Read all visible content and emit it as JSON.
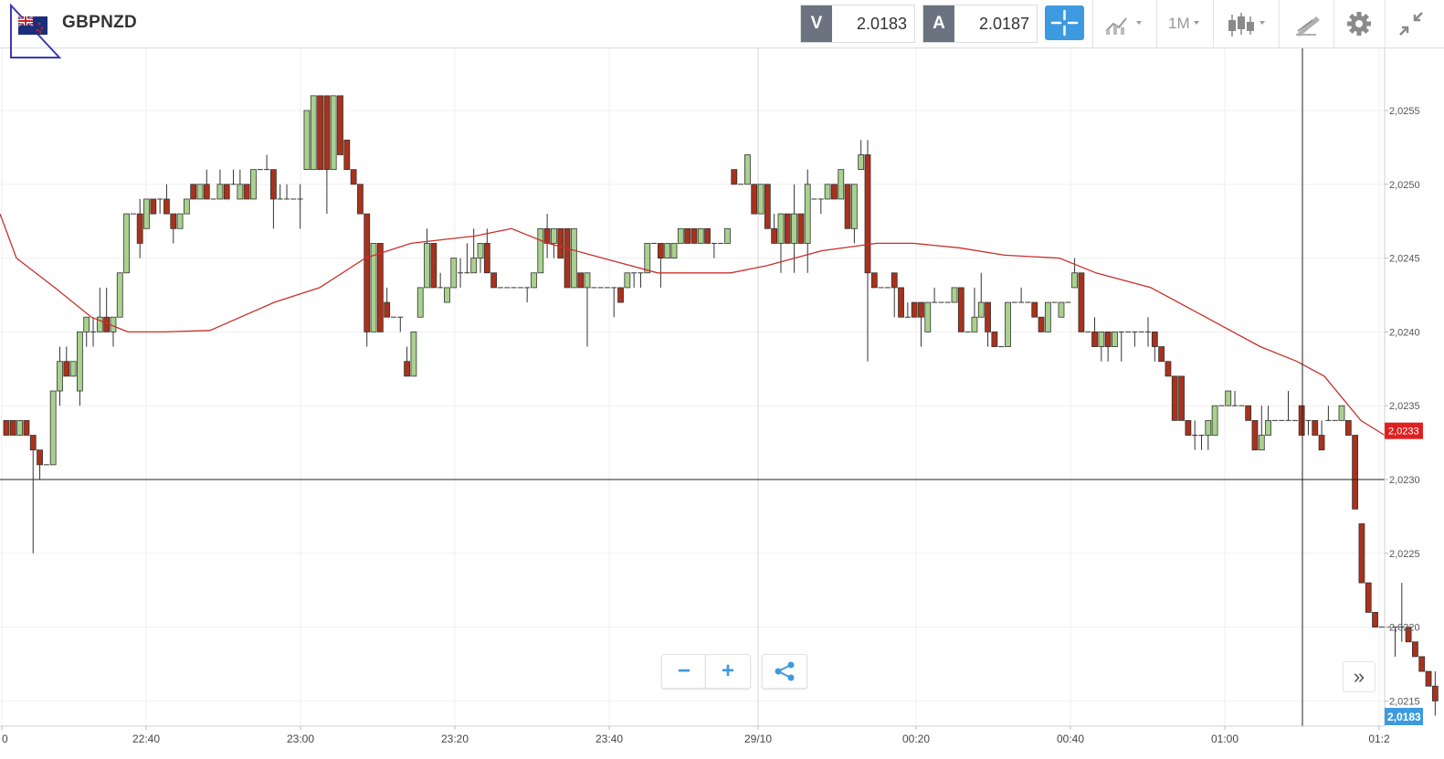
{
  "header": {
    "symbol": "GBPNZD",
    "flag_icon": "uk-nz-flag-icon",
    "sell": {
      "label": "V",
      "value": "2.0183"
    },
    "buy": {
      "label": "A",
      "value": "2.0187"
    },
    "timeframe": "1M",
    "tools": [
      "crosshair-icon",
      "indicators-icon",
      "candlestick-icon",
      "draw-icon",
      "gear-icon",
      "collapse-icon"
    ]
  },
  "chart_data": {
    "type": "candlestick",
    "y_ticks": [
      "2,0255",
      "2,0250",
      "2,0245",
      "2,0240",
      "2,0235",
      "2,0230",
      "2,0225",
      "2,0220",
      "2,0215"
    ],
    "x_ticks": [
      "0",
      "22:40",
      "23:00",
      "23:20",
      "23:40",
      "29/10",
      "00:20",
      "00:40",
      "01:00",
      "01:2"
    ],
    "ylim": [
      2.0213,
      2.0259
    ],
    "horizontal_line": 2.023,
    "crosshair_time": "01:10",
    "ma_last_label": "2,0233",
    "current_price_label": "2,0183",
    "colors": {
      "up": "#a9d18e",
      "down": "#a8321c",
      "ma": "#c8302c",
      "current_badge": "#3d9ae0",
      "ma_badge": "#e02020"
    },
    "candles": [
      [
        2.0234,
        2.0234,
        2.0233,
        2.0233
      ],
      [
        2.0234,
        2.0234,
        2.0233,
        2.0233
      ],
      [
        2.0233,
        2.0234,
        2.0233,
        2.0234
      ],
      [
        2.0234,
        2.0234,
        2.0233,
        2.0233
      ],
      [
        2.0233,
        2.0233,
        2.0225,
        2.0232
      ],
      [
        2.0232,
        2.0232,
        2.023,
        2.0231
      ],
      [
        2.0231,
        2.0231,
        2.0231,
        2.0231
      ],
      [
        2.0231,
        2.0236,
        2.0231,
        2.0236
      ],
      [
        2.0236,
        2.0239,
        2.0235,
        2.0238
      ],
      [
        2.0238,
        2.0239,
        2.0237,
        2.0237
      ],
      [
        2.0237,
        2.0238,
        2.0237,
        2.0238
      ],
      [
        2.0236,
        2.024,
        2.0235,
        2.024
      ],
      [
        2.024,
        2.0241,
        2.0239,
        2.0241
      ],
      [
        2.024,
        2.0241,
        2.0239,
        2.024
      ],
      [
        2.024,
        2.0243,
        2.024,
        2.0241
      ],
      [
        2.0241,
        2.0243,
        2.024,
        2.024
      ],
      [
        2.024,
        2.0241,
        2.0239,
        2.0241
      ],
      [
        2.0241,
        2.0244,
        2.0241,
        2.0244
      ],
      [
        2.0244,
        2.0248,
        2.0244,
        2.0248
      ],
      [
        2.0248,
        2.0248,
        2.0248,
        2.0248
      ],
      [
        2.0248,
        2.0249,
        2.0245,
        2.0246
      ],
      [
        2.0247,
        2.0249,
        2.0247,
        2.0249
      ],
      [
        2.0249,
        2.0249,
        2.0248,
        2.0248
      ],
      [
        2.0249,
        2.0249,
        2.0248,
        2.0249
      ],
      [
        2.0249,
        2.025,
        2.0248,
        2.0248
      ],
      [
        2.0248,
        2.0248,
        2.0246,
        2.0247
      ],
      [
        2.0247,
        2.0248,
        2.0247,
        2.0248
      ],
      [
        2.0248,
        2.0249,
        2.0248,
        2.0249
      ],
      [
        2.025,
        2.025,
        2.0249,
        2.0249
      ],
      [
        2.0249,
        2.025,
        2.0249,
        2.025
      ],
      [
        2.025,
        2.0251,
        2.0249,
        2.0249
      ],
      [
        2.0249,
        2.0249,
        2.0249,
        2.0249
      ],
      [
        2.0249,
        2.0251,
        2.0249,
        2.025
      ],
      [
        2.025,
        2.025,
        2.0249,
        2.0249
      ],
      [
        2.025,
        2.0251,
        2.025,
        2.025
      ],
      [
        2.0249,
        2.0251,
        2.0249,
        2.025
      ],
      [
        2.025,
        2.025,
        2.0249,
        2.0249
      ],
      [
        2.0249,
        2.0251,
        2.0249,
        2.0251
      ],
      [
        2.0251,
        2.0251,
        2.0251,
        2.0251
      ],
      [
        2.0251,
        2.0252,
        2.0251,
        2.0251
      ],
      [
        2.0251,
        2.0251,
        2.0247,
        2.0249
      ],
      [
        2.0249,
        2.025,
        2.0249,
        2.0249
      ],
      [
        2.0249,
        2.025,
        2.0249,
        2.0249
      ],
      [
        2.0249,
        2.0249,
        2.0249,
        2.0249
      ],
      [
        2.0249,
        2.025,
        2.0247,
        2.0249
      ],
      [
        2.0251,
        2.0255,
        2.0251,
        2.0255
      ],
      [
        2.0251,
        2.0256,
        2.0251,
        2.0256
      ],
      [
        2.0256,
        2.0256,
        2.0251,
        2.0251
      ],
      [
        2.0256,
        2.0256,
        2.0248,
        2.0251
      ],
      [
        2.0251,
        2.0256,
        2.0251,
        2.0256
      ],
      [
        2.0256,
        2.0256,
        2.0252,
        2.0252
      ],
      [
        2.0253,
        2.0253,
        2.0251,
        2.0251
      ],
      [
        2.0251,
        2.0251,
        2.025,
        2.025
      ],
      [
        2.025,
        2.025,
        2.0248,
        2.0248
      ],
      [
        2.0248,
        2.0248,
        2.0239,
        2.024
      ],
      [
        2.024,
        2.0246,
        2.024,
        2.0246
      ],
      [
        2.0246,
        2.0246,
        2.024,
        2.024
      ],
      [
        2.0242,
        2.0243,
        2.0241,
        2.0241
      ],
      [
        2.0241,
        2.0241,
        2.0241,
        2.0241
      ],
      [
        2.0241,
        2.0241,
        2.024,
        2.0241
      ],
      [
        2.0238,
        2.0239,
        2.0237,
        2.0237
      ],
      [
        2.0237,
        2.024,
        2.0237,
        2.024
      ],
      [
        2.0241,
        2.0243,
        2.0241,
        2.0243
      ],
      [
        2.0243,
        2.0247,
        2.0243,
        2.0246
      ],
      [
        2.0246,
        2.0246,
        2.0243,
        2.0243
      ],
      [
        2.0243,
        2.0244,
        2.0243,
        2.0243
      ],
      [
        2.0242,
        2.0243,
        2.0242,
        2.0243
      ],
      [
        2.0243,
        2.0245,
        2.0243,
        2.0245
      ],
      [
        2.0244,
        2.0245,
        2.0243,
        2.0244
      ],
      [
        2.0244,
        2.0246,
        2.0244,
        2.0244
      ],
      [
        2.0244,
        2.0247,
        2.0244,
        2.0245
      ],
      [
        2.0245,
        2.0246,
        2.0244,
        2.0246
      ],
      [
        2.0246,
        2.0247,
        2.0244,
        2.0244
      ],
      [
        2.0244,
        2.0244,
        2.0243,
        2.0243
      ],
      [
        2.0243,
        2.0243,
        2.0243,
        2.0243
      ],
      [
        2.0243,
        2.0243,
        2.0243,
        2.0243
      ],
      [
        2.0243,
        2.0243,
        2.0243,
        2.0243
      ],
      [
        2.0243,
        2.0243,
        2.0243,
        2.0243
      ],
      [
        2.0243,
        2.0243,
        2.0242,
        2.0243
      ],
      [
        2.0243,
        2.0244,
        2.0243,
        2.0244
      ],
      [
        2.0244,
        2.0247,
        2.0244,
        2.0247
      ],
      [
        2.0247,
        2.0248,
        2.0245,
        2.0246
      ],
      [
        2.0246,
        2.0247,
        2.0245,
        2.0247
      ],
      [
        2.0247,
        2.0247,
        2.0245,
        2.0245
      ],
      [
        2.0247,
        2.0247,
        2.0243,
        2.0243
      ],
      [
        2.0243,
        2.0247,
        2.0243,
        2.0247
      ],
      [
        2.0244,
        2.0244,
        2.0243,
        2.0243
      ],
      [
        2.0243,
        2.0243,
        2.0239,
        2.0244
      ],
      [
        2.0243,
        2.0243,
        2.0243,
        2.0243
      ],
      [
        2.0243,
        2.0243,
        2.0243,
        2.0243
      ],
      [
        2.0243,
        2.0243,
        2.0243,
        2.0243
      ],
      [
        2.0243,
        2.0243,
        2.0241,
        2.0243
      ],
      [
        2.0243,
        2.0243,
        2.0242,
        2.0242
      ],
      [
        2.0243,
        2.0244,
        2.0243,
        2.0244
      ],
      [
        2.0244,
        2.0244,
        2.0243,
        2.0244
      ],
      [
        2.0244,
        2.0244,
        2.0243,
        2.0244
      ],
      [
        2.0244,
        2.0246,
        2.0244,
        2.0246
      ],
      [
        2.0246,
        2.0246,
        2.0246,
        2.0246
      ],
      [
        2.0246,
        2.0246,
        2.0243,
        2.0245
      ],
      [
        2.0245,
        2.0246,
        2.0245,
        2.0246
      ],
      [
        2.0245,
        2.0246,
        2.0245,
        2.0246
      ],
      [
        2.0246,
        2.0247,
        2.0246,
        2.0247
      ],
      [
        2.0247,
        2.0247,
        2.0246,
        2.0246
      ],
      [
        2.0247,
        2.0247,
        2.0246,
        2.0246
      ],
      [
        2.0246,
        2.0247,
        2.0246,
        2.0247
      ],
      [
        2.0247,
        2.0247,
        2.0246,
        2.0246
      ],
      [
        2.0246,
        2.0246,
        2.0245,
        2.0246
      ],
      [
        2.0246,
        2.0246,
        2.0246,
        2.0246
      ],
      [
        2.0246,
        2.0246,
        2.0246,
        2.0247
      ],
      [
        2.0251,
        2.0251,
        2.025,
        2.025
      ],
      [
        2.025,
        2.025,
        2.025,
        2.025
      ],
      [
        2.025,
        2.0252,
        2.025,
        2.0252
      ],
      [
        2.025,
        2.025,
        2.0248,
        2.0248
      ],
      [
        2.0248,
        2.0248,
        2.0248,
        2.025
      ],
      [
        2.025,
        2.025,
        2.0247,
        2.0247
      ],
      [
        2.0247,
        2.0248,
        2.0246,
        2.0246
      ],
      [
        2.0246,
        2.0247,
        2.0244,
        2.0248
      ],
      [
        2.0248,
        2.0248,
        2.0246,
        2.0246
      ],
      [
        2.0246,
        2.025,
        2.0244,
        2.0248
      ],
      [
        2.0248,
        2.0248,
        2.0246,
        2.0246
      ],
      [
        2.0246,
        2.0251,
        2.0244,
        2.025
      ],
      [
        2.0249,
        2.0249,
        2.0249,
        2.0249
      ],
      [
        2.0249,
        2.0249,
        2.0248,
        2.0249
      ],
      [
        2.0249,
        2.025,
        2.0249,
        2.025
      ],
      [
        2.025,
        2.025,
        2.0249,
        2.0249
      ],
      [
        2.0249,
        2.0251,
        2.0249,
        2.0251
      ],
      [
        2.025,
        2.025,
        2.0247,
        2.0247
      ],
      [
        2.0247,
        2.025,
        2.0246,
        2.025
      ],
      [
        2.0251,
        2.0253,
        2.0251,
        2.0252
      ],
      [
        2.0252,
        2.0253,
        2.0238,
        2.0244
      ],
      [
        2.0244,
        2.0244,
        2.0243,
        2.0243
      ],
      [
        2.0243,
        2.0243,
        2.0243,
        2.0243
      ],
      [
        2.0243,
        2.0243,
        2.0243,
        2.0243
      ],
      [
        2.0244,
        2.0244,
        2.0241,
        2.0243
      ],
      [
        2.0243,
        2.0243,
        2.0241,
        2.0241
      ],
      [
        2.0241,
        2.0242,
        2.0241,
        2.0241
      ],
      [
        2.0242,
        2.0242,
        2.0241,
        2.0241
      ],
      [
        2.0242,
        2.0242,
        2.0239,
        2.0241
      ],
      [
        2.024,
        2.0242,
        2.024,
        2.0242
      ],
      [
        2.0242,
        2.0243,
        2.0242,
        2.0242
      ],
      [
        2.0242,
        2.0242,
        2.0242,
        2.0242
      ],
      [
        2.0242,
        2.0242,
        2.0242,
        2.0242
      ],
      [
        2.0242,
        2.0243,
        2.0242,
        2.0243
      ],
      [
        2.0243,
        2.0243,
        2.024,
        2.024
      ],
      [
        2.024,
        2.024,
        2.024,
        2.024
      ],
      [
        2.024,
        2.0243,
        2.024,
        2.0241
      ],
      [
        2.0241,
        2.0244,
        2.0241,
        2.0242
      ],
      [
        2.0242,
        2.0242,
        2.0239,
        2.024
      ],
      [
        2.024,
        2.024,
        2.0239,
        2.0239
      ],
      [
        2.0239,
        2.0239,
        2.0239,
        2.0239
      ],
      [
        2.0239,
        2.0242,
        2.0239,
        2.0242
      ],
      [
        2.0242,
        2.0242,
        2.0242,
        2.0242
      ],
      [
        2.0242,
        2.0243,
        2.0242,
        2.0242
      ],
      [
        2.0242,
        2.0242,
        2.0242,
        2.0242
      ],
      [
        2.0242,
        2.0242,
        2.0241,
        2.0241
      ],
      [
        2.0241,
        2.0241,
        2.024,
        2.024
      ],
      [
        2.024,
        2.0242,
        2.024,
        2.0242
      ],
      [
        2.0242,
        2.0242,
        2.0242,
        2.0242
      ],
      [
        2.0241,
        2.0242,
        2.0241,
        2.0242
      ],
      [
        2.0242,
        2.0242,
        2.0242,
        2.0242
      ],
      [
        2.0243,
        2.0245,
        2.0243,
        2.0244
      ],
      [
        2.0244,
        2.0244,
        2.024,
        2.024
      ],
      [
        2.024,
        2.024,
        2.024,
        2.024
      ],
      [
        2.024,
        2.0241,
        2.0239,
        2.0239
      ],
      [
        2.0239,
        2.024,
        2.0238,
        2.024
      ],
      [
        2.024,
        2.024,
        2.0238,
        2.0239
      ],
      [
        2.0239,
        2.024,
        2.0239,
        2.024
      ],
      [
        2.024,
        2.024,
        2.0238,
        2.024
      ],
      [
        2.024,
        2.024,
        2.024,
        2.024
      ],
      [
        2.024,
        2.024,
        2.0239,
        2.024
      ],
      [
        2.024,
        2.024,
        2.024,
        2.024
      ],
      [
        2.024,
        2.0241,
        2.0239,
        2.024
      ],
      [
        2.024,
        2.024,
        2.0238,
        2.0239
      ],
      [
        2.0239,
        2.0239,
        2.0238,
        2.0238
      ],
      [
        2.0238,
        2.0238,
        2.0237,
        2.0237
      ],
      [
        2.0237,
        2.0237,
        2.0234,
        2.0234
      ],
      [
        2.0237,
        2.0237,
        2.0234,
        2.0234
      ],
      [
        2.0234,
        2.0234,
        2.0233,
        2.0233
      ],
      [
        2.0233,
        2.0234,
        2.0232,
        2.0233
      ],
      [
        2.0233,
        2.0233,
        2.0232,
        2.0233
      ],
      [
        2.0233,
        2.0234,
        2.0232,
        2.0234
      ],
      [
        2.0233,
        2.0235,
        2.0233,
        2.0235
      ],
      [
        2.0235,
        2.0235,
        2.0235,
        2.0235
      ],
      [
        2.0235,
        2.0236,
        2.0235,
        2.0236
      ],
      [
        2.0235,
        2.0236,
        2.0235,
        2.0235
      ],
      [
        2.0235,
        2.0235,
        2.0235,
        2.0235
      ],
      [
        2.0235,
        2.0235,
        2.0234,
        2.0234
      ],
      [
        2.0234,
        2.0234,
        2.0232,
        2.0232
      ],
      [
        2.0232,
        2.0235,
        2.0232,
        2.0233
      ],
      [
        2.0233,
        2.0235,
        2.0233,
        2.0234
      ],
      [
        2.0234,
        2.0234,
        2.0234,
        2.0234
      ],
      [
        2.0234,
        2.0234,
        2.0234,
        2.0234
      ],
      [
        2.0234,
        2.0236,
        2.0234,
        2.0234
      ],
      [
        2.0234,
        2.0234,
        2.0234,
        2.0234
      ],
      [
        2.0235,
        2.0235,
        2.0233,
        2.0233
      ],
      [
        2.0234,
        2.0234,
        2.0233,
        2.0234
      ],
      [
        2.0234,
        2.0234,
        2.0233,
        2.0233
      ],
      [
        2.0233,
        2.0234,
        2.0232,
        2.0232
      ],
      [
        2.0234,
        2.0235,
        2.0234,
        2.0234
      ],
      [
        2.0234,
        2.0234,
        2.0234,
        2.0234
      ],
      [
        2.0234,
        2.0235,
        2.0234,
        2.0235
      ],
      [
        2.0234,
        2.0234,
        2.0233,
        2.0233
      ],
      [
        2.0233,
        2.0233,
        2.0228,
        2.0228
      ],
      [
        2.0227,
        2.0227,
        2.0223,
        2.0223
      ],
      [
        2.0223,
        2.0223,
        2.0221,
        2.0221
      ],
      [
        2.0221,
        2.0221,
        2.022,
        2.022
      ],
      [
        2.022,
        2.022,
        2.022,
        2.022
      ],
      [
        2.022,
        2.022,
        2.022,
        2.022
      ],
      [
        2.022,
        2.022,
        2.0218,
        2.022
      ],
      [
        2.022,
        2.0223,
        2.0219,
        2.022
      ],
      [
        2.022,
        2.022,
        2.0219,
        2.0219
      ],
      [
        2.0219,
        2.0219,
        2.0218,
        2.0218
      ],
      [
        2.0218,
        2.0218,
        2.0217,
        2.0217
      ],
      [
        2.0217,
        2.0217,
        2.0216,
        2.0216
      ],
      [
        2.0216,
        2.0217,
        2.0214,
        2.0215
      ]
    ],
    "moving_average": [
      [
        0,
        2.0248
      ],
      [
        18,
        2.0245
      ],
      [
        60,
        2.0243
      ],
      [
        100,
        2.0241
      ],
      [
        140,
        2.024
      ],
      [
        180,
        2.024
      ],
      [
        230,
        2.02401
      ],
      [
        300,
        2.0242
      ],
      [
        350,
        2.0243
      ],
      [
        400,
        2.0245
      ],
      [
        450,
        2.0246
      ],
      [
        520,
        2.02465
      ],
      [
        560,
        2.0247
      ],
      [
        600,
        2.0246
      ],
      [
        660,
        2.0245
      ],
      [
        720,
        2.0244
      ],
      [
        760,
        2.0244
      ],
      [
        800,
        2.0244
      ],
      [
        840,
        2.02445
      ],
      [
        900,
        2.02455
      ],
      [
        960,
        2.0246
      ],
      [
        1000,
        2.0246
      ],
      [
        1050,
        2.02457
      ],
      [
        1100,
        2.02452
      ],
      [
        1160,
        2.0245
      ],
      [
        1200,
        2.0244
      ],
      [
        1260,
        2.0243
      ],
      [
        1320,
        2.0241
      ],
      [
        1380,
        2.0239
      ],
      [
        1420,
        2.0238
      ],
      [
        1450,
        2.0237
      ],
      [
        1490,
        2.0234
      ],
      [
        1516,
        2.0233
      ]
    ]
  },
  "controls": {
    "zoom_out": "−",
    "zoom_in": "+",
    "share_icon": "share-icon",
    "expand_label": "»"
  }
}
